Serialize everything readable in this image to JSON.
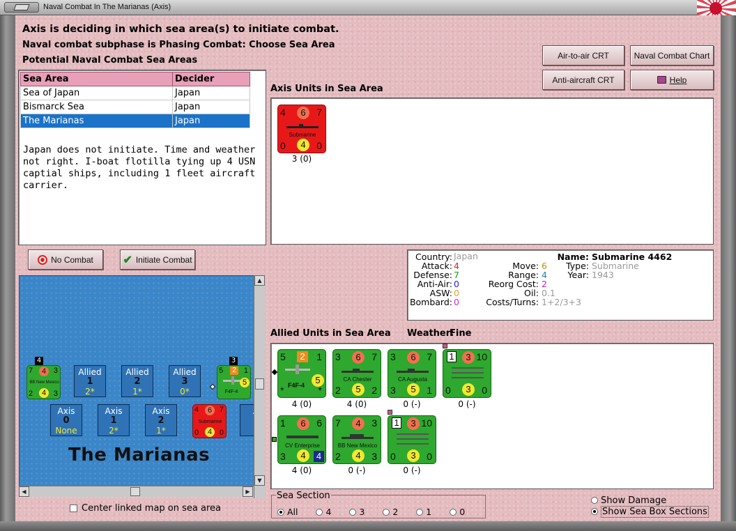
{
  "window": {
    "title": "Naval Combat In The Marianas (Axis)"
  },
  "header": {
    "line1": "Axis is deciding in which sea area(s) to initiate combat.",
    "line2": "Naval combat subphase is Phasing Combat: Choose Sea Area",
    "line3": "Potential Naval Combat Sea Areas"
  },
  "buttons": {
    "air_to_air": "Air-to-air CRT",
    "naval_chart": "Naval Combat Chart",
    "anti_aircraft": "Anti-aircraft CRT",
    "help": "Help",
    "no_combat": "No Combat",
    "initiate_combat": "Initiate Combat"
  },
  "sea_table": {
    "headers": [
      "Sea Area",
      "Decider"
    ],
    "rows": [
      {
        "area": "Sea of Japan",
        "decider": "Japan"
      },
      {
        "area": "Bismarck Sea",
        "decider": "Japan"
      },
      {
        "area": "The Marianas",
        "decider": "Japan"
      }
    ]
  },
  "description": "Japan does not initiate.  Time and weather not right.  I-boat flotilla tying up 4 USN captial ships, including 1 fleet aircraft carrier.",
  "axis_units": {
    "title": "Axis Units in Sea Area",
    "units": [
      {
        "tl": "4",
        "tc": "6",
        "tr": "7",
        "name": "Submarine",
        "bl": "0",
        "bc": "4",
        "br": "0",
        "label": "3 (0)"
      }
    ]
  },
  "info": {
    "country_k": "Country:",
    "country_v": "Japan",
    "attack_k": "Attack:",
    "attack_v": "4",
    "defense_k": "Defense:",
    "defense_v": "7",
    "antiair_k": "Anti-Air:",
    "antiair_v": "0",
    "asw_k": "ASW:",
    "asw_v": "0",
    "bombard_k": "Bombard:",
    "bombard_v": "0",
    "move_k": "Move:",
    "move_v": "6",
    "range_k": "Range:",
    "range_v": "4",
    "reorg_k": "Reorg Cost:",
    "reorg_v": "2",
    "oil_k": "Oil:",
    "oil_v": "0.1",
    "costs_k": "Costs/Turns:",
    "costs_v": "1+2/3+3",
    "name_k": "Name:",
    "name_v": "Submarine 4462",
    "type_k": "Type:",
    "type_v": "Submarine",
    "year_k": "Year:",
    "year_v": "1943"
  },
  "allied": {
    "title": "Allied Units in Sea Area",
    "weather_label": "Weather:",
    "weather": "Fine",
    "units": [
      {
        "tl": "5",
        "top": "2",
        "tr": "1",
        "name": "F4F-4",
        "bl": "*",
        "bc": "5",
        "br": "*",
        "label": "4 (0)"
      },
      {
        "tl": "3",
        "top": "6",
        "tr": "7",
        "name": "CA Chester",
        "bl": "2",
        "bc": "5",
        "br": "2",
        "label": "4 (0)"
      },
      {
        "tl": "3",
        "top": "6",
        "tr": "7",
        "name": "CA Augusta",
        "bl": "3",
        "bc": "5",
        "br": "1",
        "label": "0 (-)"
      },
      {
        "tl": "1",
        "top": "3",
        "tr": "10",
        "name": "",
        "bl": "0",
        "bc": "3",
        "br": "0",
        "label": "0 (-)"
      },
      {
        "tl": "1",
        "top": "6",
        "tr": "6",
        "name": "CV Enterprise",
        "bl": "3",
        "bc": "4",
        "br": "4",
        "label": "4 (0)"
      },
      {
        "tl": "7",
        "top": "4",
        "tr": "3",
        "name": "BB New Mexico",
        "bl": "2",
        "bc": "4",
        "br": "3",
        "label": "0 (-)"
      },
      {
        "tl": "1",
        "top": "3",
        "tr": "10",
        "name": "",
        "bl": "0",
        "bc": "3",
        "br": "0",
        "label": "0 (-)"
      }
    ]
  },
  "map": {
    "title": "The Marianas",
    "allied_boxes": [
      {
        "side": "Allied",
        "num": "1",
        "val": "2*"
      },
      {
        "side": "Allied",
        "num": "2",
        "val": "1*"
      },
      {
        "side": "Allied",
        "num": "3",
        "val": "0*"
      }
    ],
    "axis_boxes": [
      {
        "side": "Axis",
        "num": "0",
        "val": "None"
      },
      {
        "side": "Axis",
        "num": "1",
        "val": "2*"
      },
      {
        "side": "Axis",
        "num": "2",
        "val": "1*"
      }
    ],
    "partial_axis": "A",
    "stack_left": {
      "badge": "4",
      "tl": "7",
      "tc": "4",
      "tr": "3",
      "name": "BB New Mexico",
      "bl": "2",
      "bc": "4",
      "br": "3"
    },
    "stack_right": {
      "badge": "3",
      "tl": "5",
      "tc": "2",
      "tr": "1",
      "name": "F4F-4",
      "bc": "5"
    },
    "map_sub": {
      "tl": "4",
      "tc": "6",
      "tr": "7",
      "name": "Submarine",
      "bl": "0",
      "bc": "4",
      "br": "0"
    }
  },
  "center_map_label": "Center linked map on sea area",
  "sea_section": {
    "label": "Sea Section",
    "options": [
      "All",
      "4",
      "3",
      "2",
      "1",
      "0"
    ]
  },
  "show_damage": "Show Damage",
  "show_sections": "Show Sea Box Sections",
  "colors": {
    "background": "#e4bcc0",
    "selected_row": "#1a73c8",
    "unit_green": "#2ea82e",
    "unit_red": "#e81818",
    "sea_blue": "#3b86c8"
  }
}
